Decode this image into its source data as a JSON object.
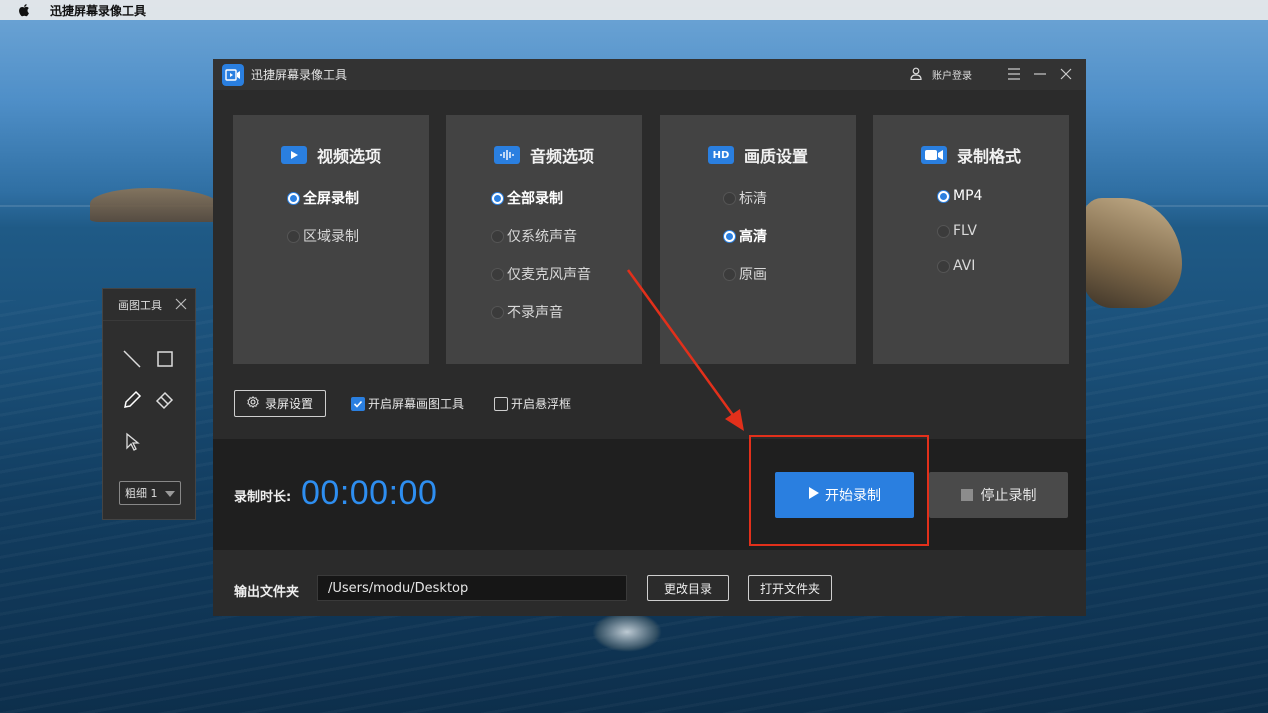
{
  "menubar": {
    "app_name": "迅捷屏幕录像工具"
  },
  "drawing_tool": {
    "title": "画图工具",
    "thickness_label": "粗细 1"
  },
  "window": {
    "title": "迅捷屏幕录像工具",
    "login_label": "账户登录"
  },
  "cards": {
    "video": {
      "title": "视频选项",
      "icon_text": "▶",
      "options": [
        "全屏录制",
        "区域录制"
      ],
      "selected": "全屏录制"
    },
    "audio": {
      "title": "音频选项",
      "icon_text": "ıllı",
      "options": [
        "全部录制",
        "仅系统声音",
        "仅麦克风声音",
        "不录声音"
      ],
      "selected": "全部录制"
    },
    "quality": {
      "title": "画质设置",
      "icon_text": "HD",
      "options": [
        "标清",
        "高清",
        "原画"
      ],
      "selected": "高清"
    },
    "format": {
      "title": "录制格式",
      "icon_text": "■◀",
      "options": [
        "MP4",
        "FLV",
        "AVI"
      ],
      "selected": "MP4"
    }
  },
  "settings": {
    "record_settings_label": "录屏设置",
    "enable_drawing_label": "开启屏幕画图工具",
    "enable_drawing_checked": true,
    "enable_float_label": "开启悬浮框",
    "enable_float_checked": false
  },
  "recording": {
    "duration_label": "录制时长:",
    "timer": "00:00:00",
    "start_label": "开始录制",
    "stop_label": "停止录制"
  },
  "output": {
    "folder_label": "输出文件夹",
    "path": "/Users/modu/Desktop",
    "change_dir_label": "更改目录",
    "open_folder_label": "打开文件夹"
  },
  "colors": {
    "accent": "#2a7fe0",
    "highlight": "#e2301b"
  }
}
